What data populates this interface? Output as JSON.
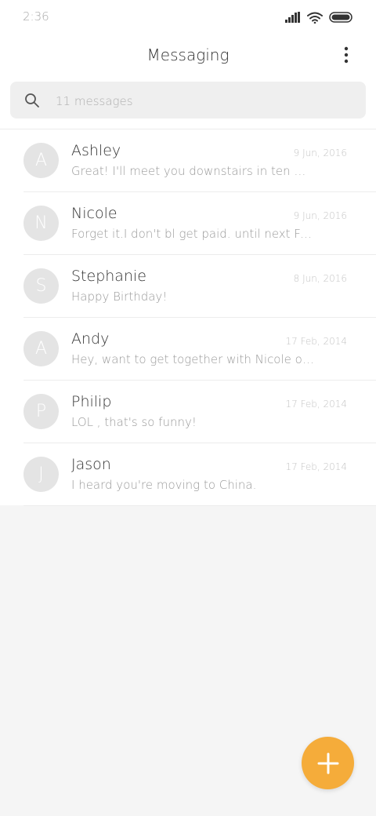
{
  "status_bar": {
    "time": "2:36",
    "icons": [
      "signal-icon",
      "wifi-icon",
      "battery-icon"
    ]
  },
  "header": {
    "title": "Messaging",
    "menu_icon": "more-vert-icon"
  },
  "search": {
    "placeholder": "11 messages",
    "value": "",
    "icon": "search-icon"
  },
  "conversations": [
    {
      "initial": "A",
      "name": "Ashley",
      "date": "9 Jun, 2016",
      "preview": "Great! I'll meet you downstairs in ten minutes."
    },
    {
      "initial": "N",
      "name": "Nicole",
      "date": "9 Jun, 2016",
      "preview": "Forget it.I don't bl get paid. until next Friday."
    },
    {
      "initial": "S",
      "name": "Stephanie",
      "date": "8 Jun, 2016",
      "preview": "Happy Birthday!"
    },
    {
      "initial": "A",
      "name": "Andy",
      "date": "17 Feb, 2014",
      "preview": "Hey, want to get together with Nicole on Friday?"
    },
    {
      "initial": "P",
      "name": "Philip",
      "date": "17 Feb, 2014",
      "preview": "LOL , that's so funny!"
    },
    {
      "initial": "J",
      "name": "Jason",
      "date": "17 Feb, 2014",
      "preview": "I heard you're moving to China."
    }
  ],
  "fab": {
    "icon": "plus-icon"
  },
  "colors": {
    "accent": "#f5ac3a",
    "avatar_bg": "#e4e4e4",
    "background": "#f5f5f5"
  }
}
